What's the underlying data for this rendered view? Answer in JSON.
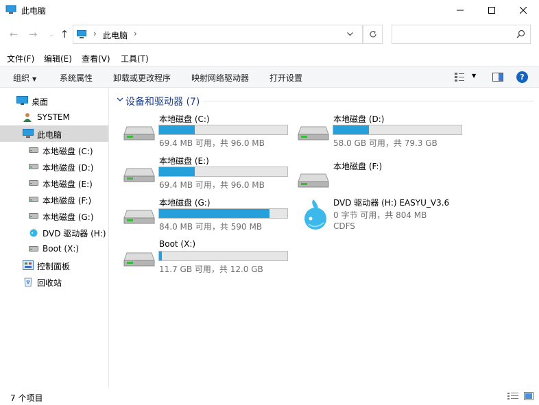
{
  "window": {
    "title": "此电脑"
  },
  "address": {
    "path": "此电脑",
    "search_placeholder": ""
  },
  "menu": [
    "文件(F)",
    "编辑(E)",
    "查看(V)",
    "工具(T)"
  ],
  "commands": {
    "organize": "组织",
    "system_properties": "系统属性",
    "uninstall": "卸载或更改程序",
    "map_drive": "映射网络驱动器",
    "open_settings": "打开设置",
    "help": "?"
  },
  "sidebar": [
    {
      "label": "桌面"
    },
    {
      "label": "SYSTEM"
    },
    {
      "label": "此电脑"
    },
    {
      "label": "本地磁盘 (C:)"
    },
    {
      "label": "本地磁盘 (D:)"
    },
    {
      "label": "本地磁盘 (E:)"
    },
    {
      "label": "本地磁盘 (F:)"
    },
    {
      "label": "本地磁盘 (G:)"
    },
    {
      "label": "DVD 驱动器 (H:)"
    },
    {
      "label": "Boot (X:)"
    },
    {
      "label": "控制面板"
    },
    {
      "label": "回收站"
    }
  ],
  "group": {
    "title": "设备和驱动器 (7)"
  },
  "drives": [
    {
      "name": "本地磁盘 (C:)",
      "info": "69.4 MB 可用，共 96.0 MB",
      "used_fraction": 0.28
    },
    {
      "name": "本地磁盘 (D:)",
      "info": "58.0 GB 可用，共 79.3 GB",
      "used_fraction": 0.28
    },
    {
      "name": "本地磁盘 (E:)",
      "info": "69.4 MB 可用，共 96.0 MB",
      "used_fraction": 0.28
    },
    {
      "name": "本地磁盘 (F:)",
      "info": "",
      "used_fraction": null
    },
    {
      "name": "本地磁盘 (G:)",
      "info": "84.0 MB 可用，共 590 MB",
      "used_fraction": 0.86
    },
    {
      "name": "Boot (X:)",
      "info": "11.7 GB 可用，共 12.0 GB",
      "used_fraction": 0.02
    }
  ],
  "dvd": {
    "name": "DVD 驱动器 (H:) EASYU_V3.6",
    "info": "0 字节 可用，共 804 MB",
    "fs": "CDFS"
  },
  "status": {
    "count": "7 个项目"
  },
  "colors": {
    "accent": "#26a0da",
    "selected": "#d9d9d9",
    "group_title": "#1e3f8d"
  }
}
